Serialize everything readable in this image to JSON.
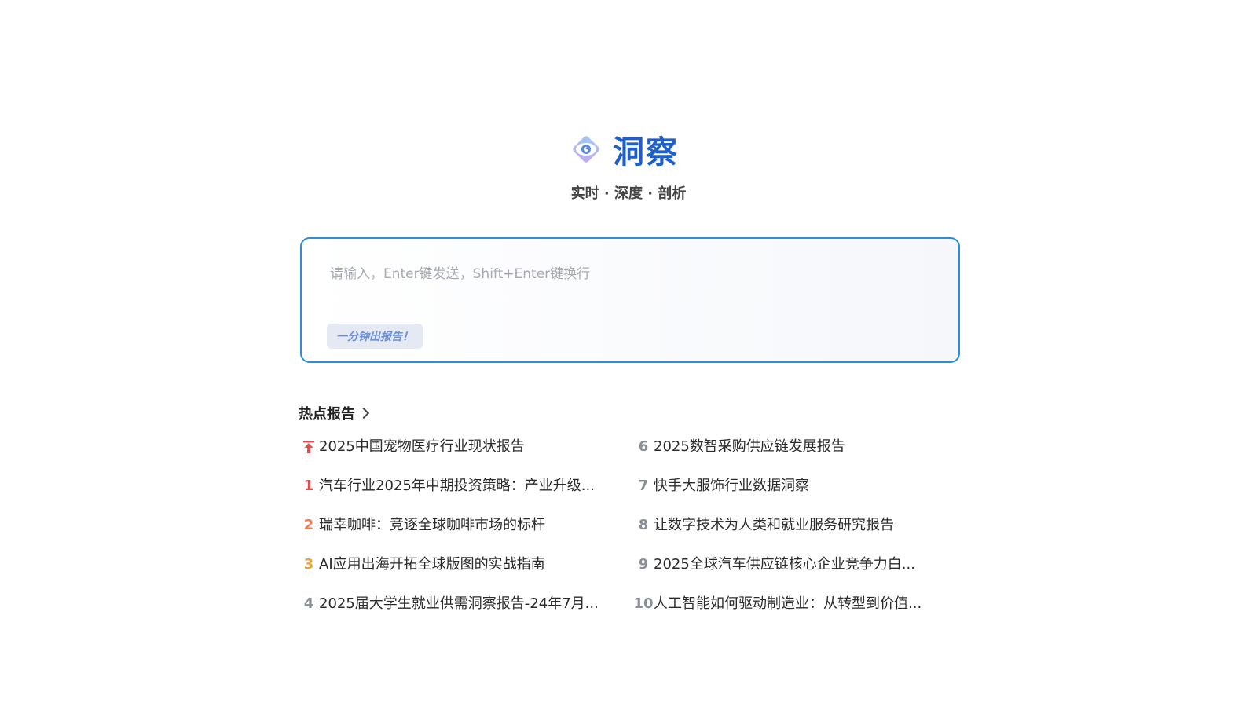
{
  "brand": {
    "name": "洞察",
    "tagline": "实时 · 深度 · 剖析",
    "icon": "eye-diamond-icon",
    "color": "#1f5fc9"
  },
  "input": {
    "placeholder": "请输入，Enter键发送，Shift+Enter键换行",
    "value": "",
    "chip_label": "一分钟出报告！"
  },
  "hot": {
    "heading": "热点报告",
    "left_items": [
      {
        "rank": "",
        "pinned": true,
        "title": "2025中国宠物医疗行业现状报告",
        "rank_color": "#e04b4b"
      },
      {
        "rank": "1",
        "title": "汽车行业2025年中期投资策略：产业升级...",
        "rank_color": "#e04b4b"
      },
      {
        "rank": "2",
        "title": "瑞幸咖啡：竞逐全球咖啡市场的标杆",
        "rank_color": "#ec7b4f"
      },
      {
        "rank": "3",
        "title": "AI应用出海开拓全球版图的实战指南",
        "rank_color": "#e6a23c"
      },
      {
        "rank": "4",
        "title": "2025届大学生就业供需洞察报告-24年7月...",
        "rank_color": "#8a8f98"
      }
    ],
    "right_items": [
      {
        "rank": "6",
        "title": "2025数智采购供应链发展报告",
        "rank_color": "#8a8f98"
      },
      {
        "rank": "7",
        "title": "快手大服饰行业数据洞察",
        "rank_color": "#8a8f98"
      },
      {
        "rank": "8",
        "title": "让数字技术为人类和就业服务研究报告",
        "rank_color": "#8a8f98"
      },
      {
        "rank": "9",
        "title": "2025全球汽车供应链核心企业竞争力白...",
        "rank_color": "#8a8f98"
      },
      {
        "rank": "10",
        "title": "人工智能如何驱动制造业：从转型到价值...",
        "rank_color": "#8a8f98"
      }
    ]
  }
}
